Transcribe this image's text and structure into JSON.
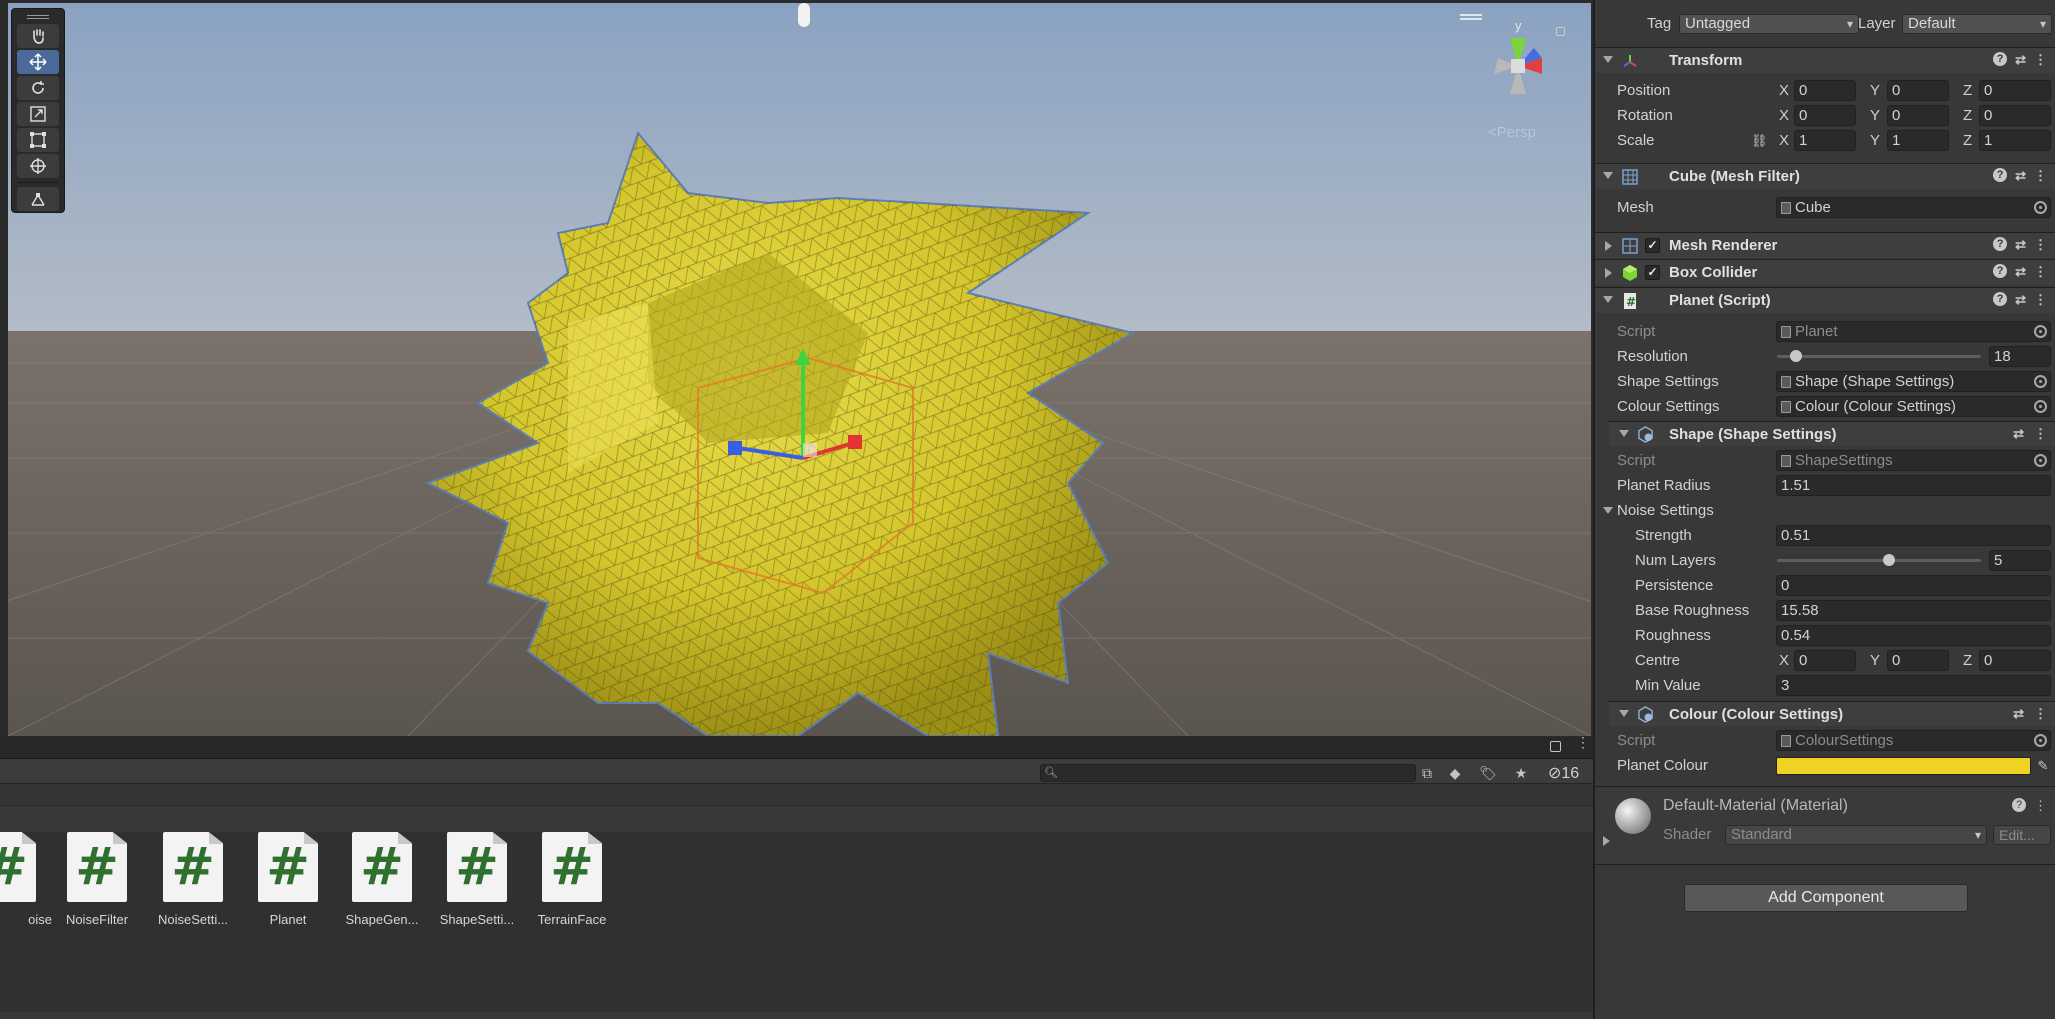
{
  "scene": {
    "persp_label": "<Persp",
    "gizmo_axis_label": "y",
    "tools": [
      "hand",
      "move",
      "rotate",
      "scale",
      "rect",
      "transform",
      "custom"
    ]
  },
  "project": {
    "search_placeholder": "",
    "hidden_count": "16",
    "assets": [
      {
        "name": "oise"
      },
      {
        "name": "NoiseFilter"
      },
      {
        "name": "NoiseSetti..."
      },
      {
        "name": "Planet"
      },
      {
        "name": "ShapeGen..."
      },
      {
        "name": "ShapeSetti..."
      },
      {
        "name": "TerrainFace"
      }
    ]
  },
  "inspector": {
    "tag_label": "Tag",
    "tag_value": "Untagged",
    "layer_label": "Layer",
    "layer_value": "Default",
    "transform": {
      "title": "Transform",
      "position": {
        "label": "Position",
        "x": "0",
        "y": "0",
        "z": "0"
      },
      "rotation": {
        "label": "Rotation",
        "x": "0",
        "y": "0",
        "z": "0"
      },
      "scale": {
        "label": "Scale",
        "x": "1",
        "y": "1",
        "z": "1"
      }
    },
    "mesh_filter": {
      "title": "Cube (Mesh Filter)",
      "mesh_label": "Mesh",
      "mesh_value": "Cube"
    },
    "mesh_renderer": {
      "title": "Mesh Renderer"
    },
    "box_collider": {
      "title": "Box Collider"
    },
    "planet_script": {
      "title": "Planet (Script)",
      "script_label": "Script",
      "script_value": "Planet",
      "resolution_label": "Resolution",
      "resolution_value": "18",
      "resolution_fraction": 0.07,
      "shape_settings_label": "Shape Settings",
      "shape_settings_value": "Shape (Shape Settings)",
      "colour_settings_label": "Colour Settings",
      "colour_settings_value": "Colour (Colour Settings)"
    },
    "shape_settings": {
      "title": "Shape (Shape Settings)",
      "script_label": "Script",
      "script_value": "ShapeSettings",
      "radius_label": "Planet Radius",
      "radius_value": "1.51",
      "noise_label": "Noise Settings",
      "strength_label": "Strength",
      "strength_value": "0.51",
      "layers_label": "Num Layers",
      "layers_value": "5",
      "layers_fraction": 0.55,
      "persistence_label": "Persistence",
      "persistence_value": "0",
      "base_roughness_label": "Base Roughness",
      "base_roughness_value": "15.58",
      "roughness_label": "Roughness",
      "roughness_value": "0.54",
      "centre_label": "Centre",
      "centre_x": "0",
      "centre_y": "0",
      "centre_z": "0",
      "min_value_label": "Min Value",
      "min_value_value": "3"
    },
    "colour_settings": {
      "title": "Colour (Colour Settings)",
      "script_label": "Script",
      "script_value": "ColourSettings",
      "planet_colour_label": "Planet Colour",
      "planet_colour_hex": "#f0d322"
    },
    "material": {
      "title": "Default-Material (Material)",
      "shader_label": "Shader",
      "shader_value": "Standard",
      "edit_label": "Edit..."
    },
    "add_component_label": "Add Component",
    "axis": {
      "x": "X",
      "y": "Y",
      "z": "Z"
    }
  }
}
